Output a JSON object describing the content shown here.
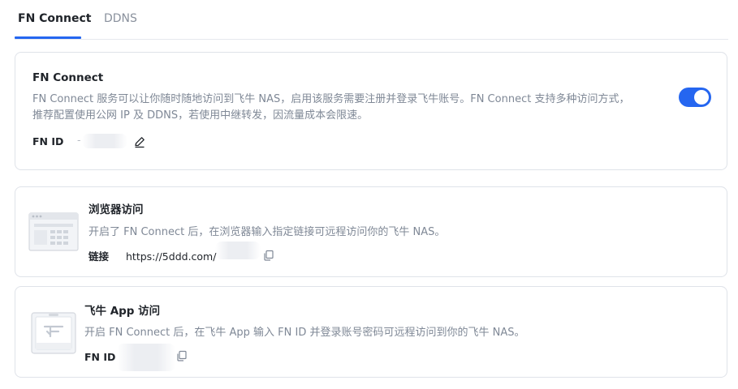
{
  "tabs": [
    {
      "label": "FN Connect",
      "active": true
    },
    {
      "label": "DDNS",
      "active": false
    }
  ],
  "fn_connect": {
    "title": "FN Connect",
    "desc_line1": "FN Connect 服务可以让你随时随地访问到飞牛 NAS，启用该服务需要注册并登录飞牛账号。FN Connect 支持多种访问方式，",
    "desc_line2": "推荐配置使用公网 IP 及 DDNS，若使用中继转发，因流量成本会限速。",
    "id_label": "FN ID",
    "id_value_prefix": "-",
    "enabled": true,
    "edit_icon": "pencil-icon"
  },
  "browser_access": {
    "title": "浏览器访问",
    "desc": "开启了 FN Connect 后，在浏览器输入指定链接可远程访问你的飞牛 NAS。",
    "link_label": "链接",
    "link_value": "https://5ddd.com/",
    "copy_icon": "copy-icon",
    "illustration": "browser-window-icon"
  },
  "app_access": {
    "title": "飞牛 App 访问",
    "desc": "开启 FN Connect 后，在飞牛 App 输入 FN ID 并登录账号密码可远程访问到你的飞牛 NAS。",
    "id_label": "FN ID",
    "copy_icon": "copy-icon",
    "illustration": "phone-app-icon"
  },
  "colors": {
    "accent": "#2566f0",
    "text_primary": "#1f2329",
    "text_secondary": "#7f8896",
    "border": "#dfe3e9"
  }
}
